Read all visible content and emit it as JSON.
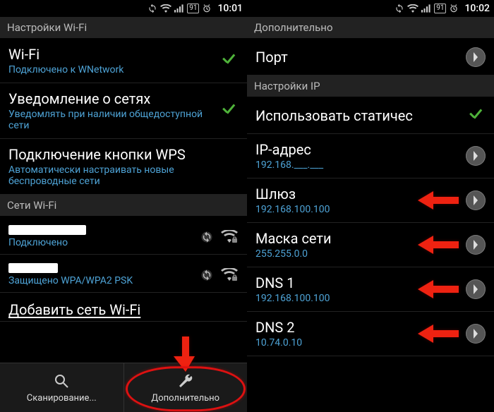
{
  "left": {
    "status": {
      "battery": "91",
      "time": "10:01"
    },
    "header1": "Настройки Wi-Fi",
    "wifi": {
      "title": "Wi-Fi",
      "sub": "Подключено к WNetwork"
    },
    "notify": {
      "title": "Уведомление о сетях",
      "sub": "Уведомлять при наличии общедоступной сети"
    },
    "wps": {
      "title": "Подключение кнопки WPS",
      "sub": "Автоматически настраивать новые беспроводные сети"
    },
    "header2": "Сети Wi-Fi",
    "net1": {
      "sub": "Подключено"
    },
    "net2": {
      "sub": "Защищено WPA/WPA2 PSK"
    },
    "add": "Добавить сеть Wi-Fi",
    "bb1": "Сканирование...",
    "bb2": "Дополнительно"
  },
  "right": {
    "status": {
      "battery": "91",
      "time": "10:02"
    },
    "header1": "Дополнительно",
    "port": {
      "title": "Порт"
    },
    "header2": "Настройки IP",
    "static": {
      "title": "Использовать статичес"
    },
    "ip": {
      "title": "IP-адрес",
      "sub": "192.168.___.___"
    },
    "gw": {
      "title": "Шлюз",
      "sub": "192.168.100.100"
    },
    "mask": {
      "title": "Маска сети",
      "sub": "255.255.0.0"
    },
    "dns1": {
      "title": "DNS 1",
      "sub": "192.168.100.100"
    },
    "dns2": {
      "title": "DNS 2",
      "sub": "10.74.0.10"
    }
  }
}
